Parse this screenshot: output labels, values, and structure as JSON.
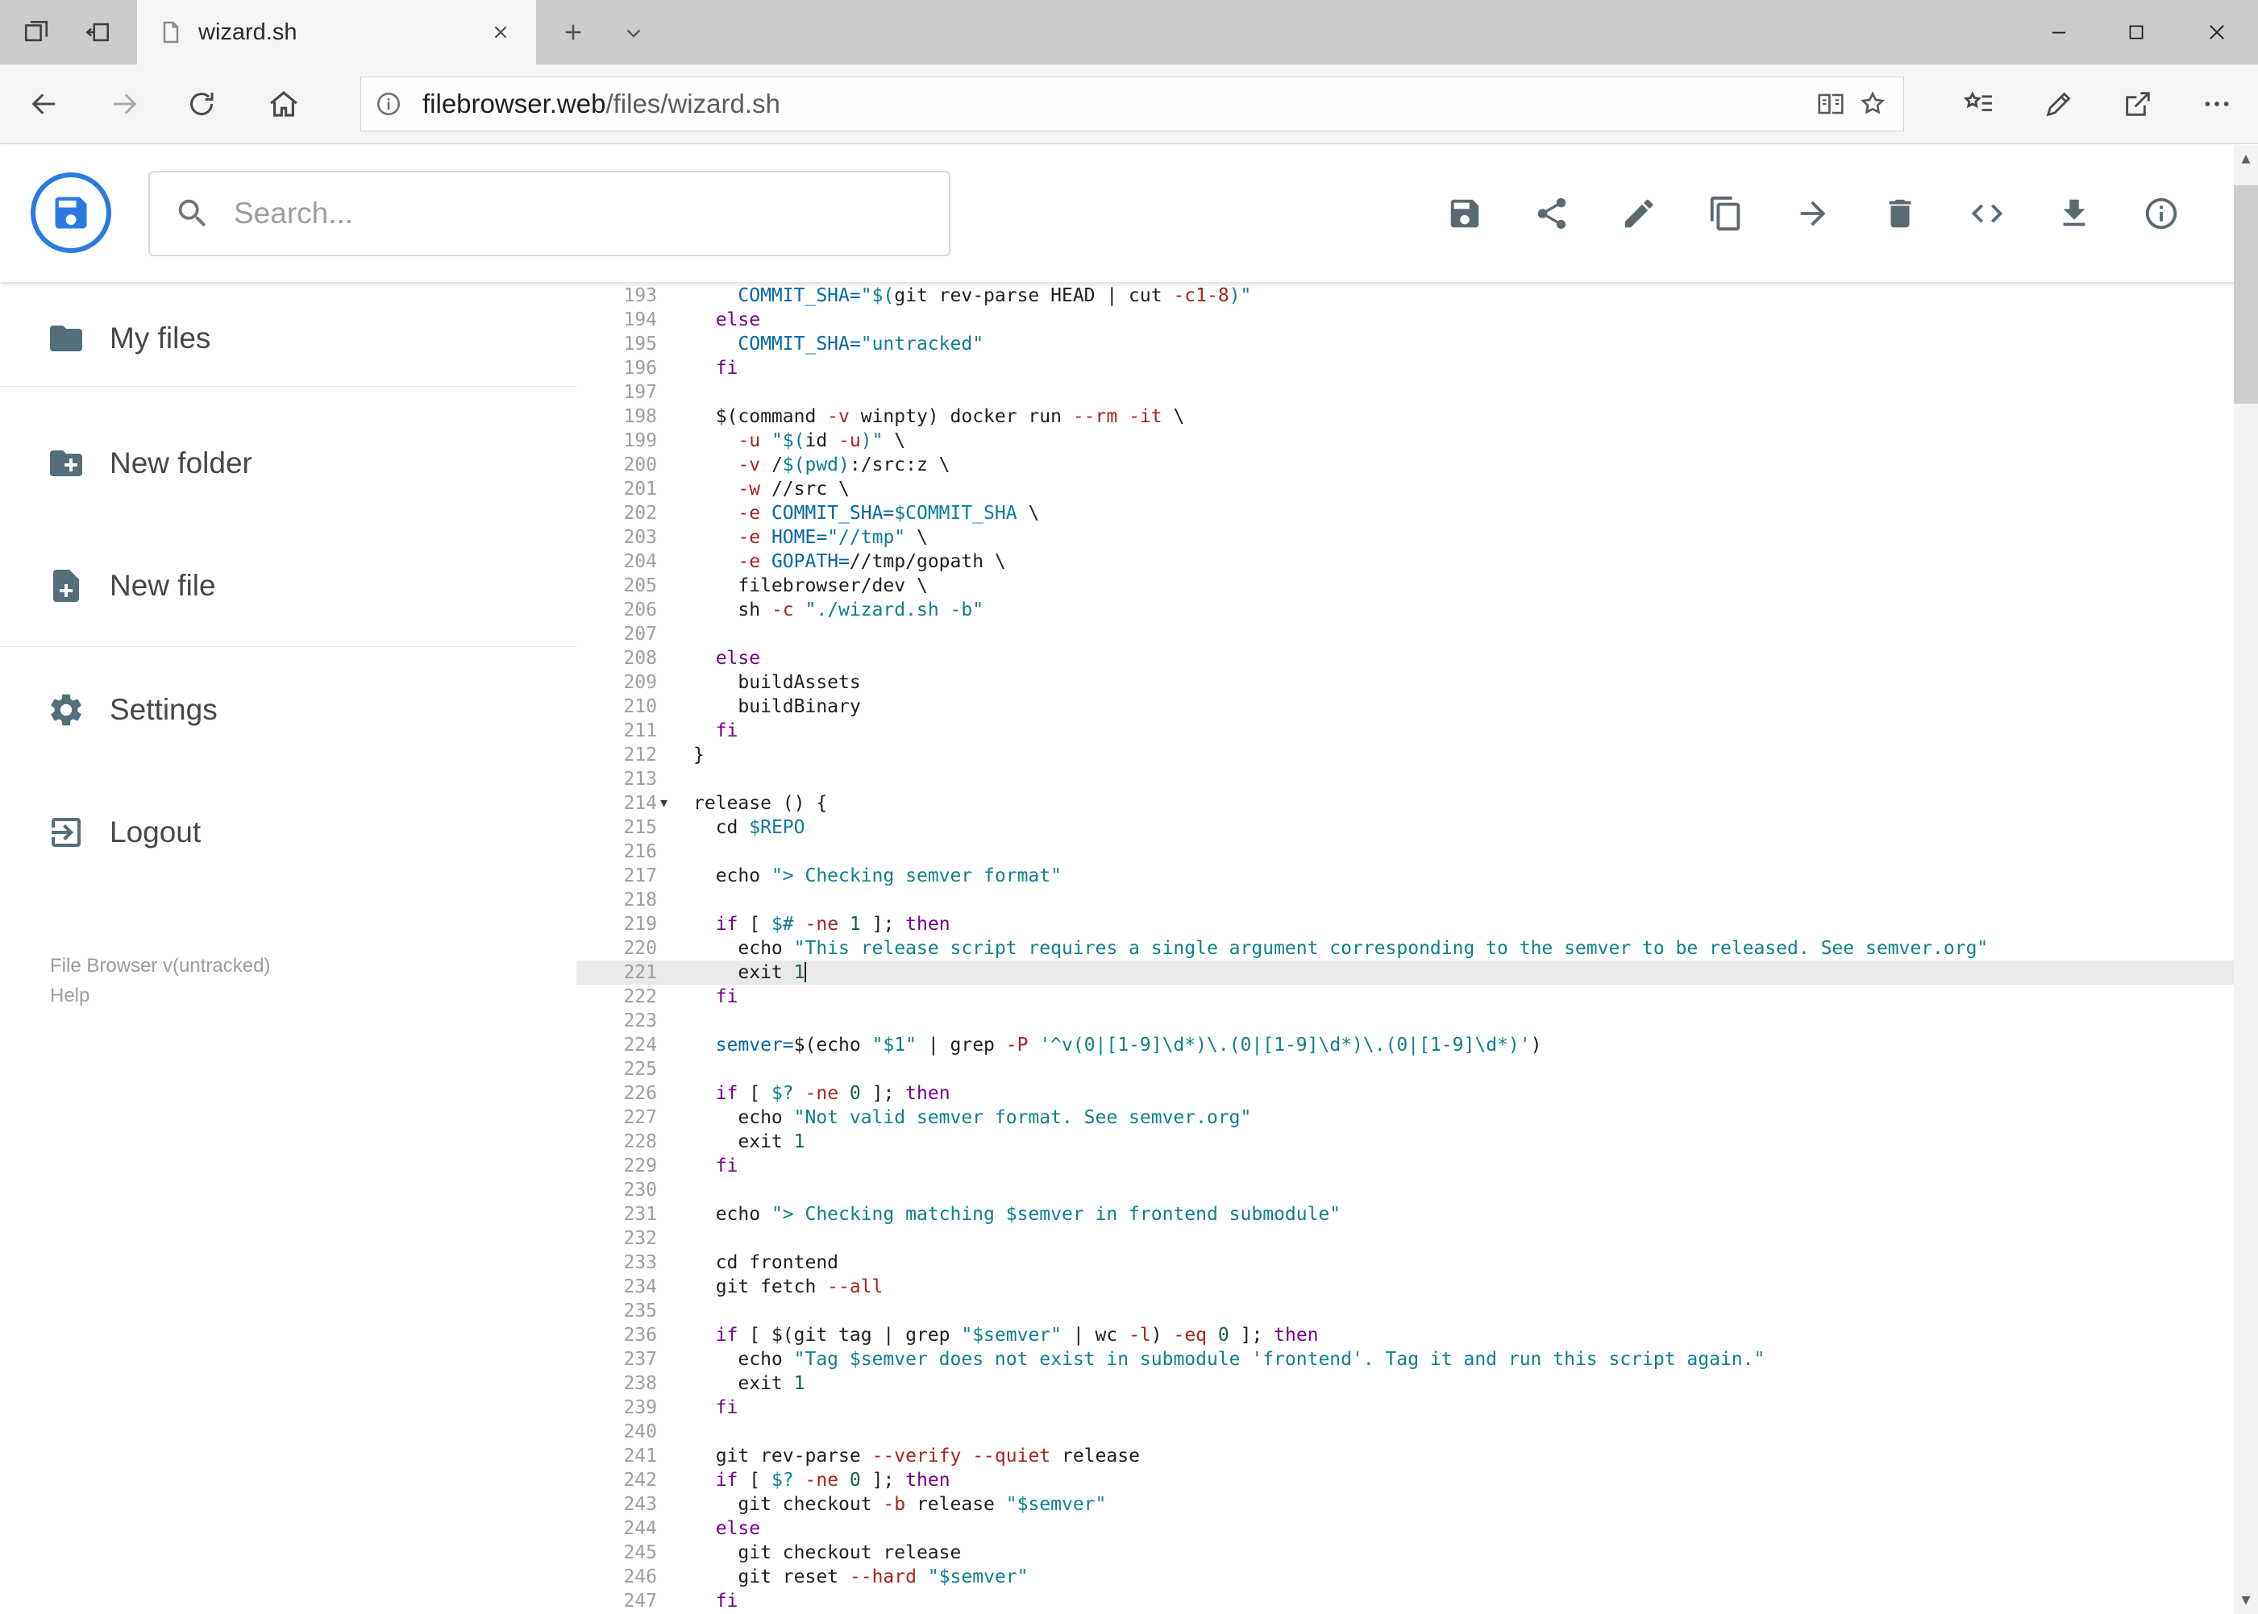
{
  "browser": {
    "tab_title": "wizard.sh",
    "url_host": "filebrowser.web",
    "url_path": "/files/wizard.sh"
  },
  "header": {
    "search_placeholder": "Search...",
    "action_icons": [
      "save",
      "share",
      "edit",
      "copy",
      "move",
      "delete",
      "code",
      "download",
      "info"
    ]
  },
  "sidebar": {
    "items": [
      {
        "icon": "folder",
        "label": "My files"
      },
      {
        "icon": "new-folder",
        "label": "New folder"
      },
      {
        "icon": "new-file",
        "label": "New file"
      },
      {
        "icon": "settings",
        "label": "Settings"
      },
      {
        "icon": "logout",
        "label": "Logout"
      }
    ],
    "footer_version": "File Browser v(untracked)",
    "footer_help": "Help"
  },
  "colors": {
    "accent_blue": "#2a7ae2",
    "header_icon_gray": "#5b6970",
    "sidebar_icon_gray": "#546e7a",
    "active_line_bg": "#e9e9e9"
  },
  "editor": {
    "active_line": 221,
    "fold_line": 214,
    "colors": {
      "p": "#1f1f1f",
      "k": "#770088",
      "s": "#0e7f8e",
      "d": "#0566a6",
      "v": "#0c7d99",
      "num": "#116644",
      "f": "#aa2222",
      "gutter": "#9e9e9e"
    },
    "lines": [
      {
        "n": 193,
        "segs": [
          [
            "p",
            "    "
          ],
          [
            "d",
            "COMMIT_SHA="
          ],
          [
            "s",
            "\"$("
          ],
          [
            "p",
            "git rev-parse HEAD | cut "
          ],
          [
            "f",
            "-c1-8"
          ],
          [
            "s",
            ")\""
          ]
        ]
      },
      {
        "n": 194,
        "segs": [
          [
            "p",
            "  "
          ],
          [
            "k",
            "else"
          ]
        ]
      },
      {
        "n": 195,
        "segs": [
          [
            "p",
            "    "
          ],
          [
            "d",
            "COMMIT_SHA="
          ],
          [
            "s",
            "\"untracked\""
          ]
        ]
      },
      {
        "n": 196,
        "segs": [
          [
            "p",
            "  "
          ],
          [
            "k",
            "fi"
          ]
        ]
      },
      {
        "n": 197,
        "segs": []
      },
      {
        "n": 198,
        "segs": [
          [
            "p",
            "  $(command "
          ],
          [
            "f",
            "-v"
          ],
          [
            "p",
            " winpty) docker run "
          ],
          [
            "f",
            "--rm"
          ],
          [
            "p",
            " "
          ],
          [
            "f",
            "-it"
          ],
          [
            "p",
            " \\"
          ]
        ]
      },
      {
        "n": 199,
        "segs": [
          [
            "p",
            "    "
          ],
          [
            "f",
            "-u"
          ],
          [
            "p",
            " "
          ],
          [
            "s",
            "\"$("
          ],
          [
            "p",
            "id "
          ],
          [
            "f",
            "-u"
          ],
          [
            "s",
            ")\""
          ],
          [
            "p",
            " \\"
          ]
        ]
      },
      {
        "n": 200,
        "segs": [
          [
            "p",
            "    "
          ],
          [
            "f",
            "-v"
          ],
          [
            "p",
            " /"
          ],
          [
            "v",
            "$(pwd)"
          ],
          [
            "p",
            ":/src:z \\"
          ]
        ]
      },
      {
        "n": 201,
        "segs": [
          [
            "p",
            "    "
          ],
          [
            "f",
            "-w"
          ],
          [
            "p",
            " //src \\"
          ]
        ]
      },
      {
        "n": 202,
        "segs": [
          [
            "p",
            "    "
          ],
          [
            "f",
            "-e"
          ],
          [
            "p",
            " "
          ],
          [
            "d",
            "COMMIT_SHA="
          ],
          [
            "v",
            "$COMMIT_SHA"
          ],
          [
            "p",
            " \\"
          ]
        ]
      },
      {
        "n": 203,
        "segs": [
          [
            "p",
            "    "
          ],
          [
            "f",
            "-e"
          ],
          [
            "p",
            " "
          ],
          [
            "d",
            "HOME="
          ],
          [
            "s",
            "\"//tmp\""
          ],
          [
            "p",
            " \\"
          ]
        ]
      },
      {
        "n": 204,
        "segs": [
          [
            "p",
            "    "
          ],
          [
            "f",
            "-e"
          ],
          [
            "p",
            " "
          ],
          [
            "d",
            "GOPATH="
          ],
          [
            "p",
            "//tmp/gopath \\"
          ]
        ]
      },
      {
        "n": 205,
        "segs": [
          [
            "p",
            "    filebrowser/dev \\"
          ]
        ]
      },
      {
        "n": 206,
        "segs": [
          [
            "p",
            "    sh "
          ],
          [
            "f",
            "-c"
          ],
          [
            "p",
            " "
          ],
          [
            "s",
            "\"./wizard.sh -b\""
          ]
        ]
      },
      {
        "n": 207,
        "segs": []
      },
      {
        "n": 208,
        "segs": [
          [
            "p",
            "  "
          ],
          [
            "k",
            "else"
          ]
        ]
      },
      {
        "n": 209,
        "segs": [
          [
            "p",
            "    buildAssets"
          ]
        ]
      },
      {
        "n": 210,
        "segs": [
          [
            "p",
            "    buildBinary"
          ]
        ]
      },
      {
        "n": 211,
        "segs": [
          [
            "p",
            "  "
          ],
          [
            "k",
            "fi"
          ]
        ]
      },
      {
        "n": 212,
        "segs": [
          [
            "p",
            "}"
          ]
        ]
      },
      {
        "n": 213,
        "segs": []
      },
      {
        "n": 214,
        "fold": true,
        "segs": [
          [
            "p",
            "release () {"
          ]
        ]
      },
      {
        "n": 215,
        "segs": [
          [
            "p",
            "  cd "
          ],
          [
            "v",
            "$REPO"
          ]
        ]
      },
      {
        "n": 216,
        "segs": []
      },
      {
        "n": 217,
        "segs": [
          [
            "p",
            "  echo "
          ],
          [
            "s",
            "\"> Checking semver format\""
          ]
        ]
      },
      {
        "n": 218,
        "segs": []
      },
      {
        "n": 219,
        "segs": [
          [
            "p",
            "  "
          ],
          [
            "k",
            "if"
          ],
          [
            "p",
            " [ "
          ],
          [
            "v",
            "$#"
          ],
          [
            "p",
            " "
          ],
          [
            "f",
            "-ne"
          ],
          [
            "p",
            " "
          ],
          [
            "num",
            "1"
          ],
          [
            "p",
            " ]; "
          ],
          [
            "k",
            "then"
          ]
        ]
      },
      {
        "n": 220,
        "segs": [
          [
            "p",
            "    echo "
          ],
          [
            "s",
            "\"This release script requires a single argument corresponding to the semver to be released. See semver.org\""
          ]
        ]
      },
      {
        "n": 221,
        "active": true,
        "cursor": true,
        "segs": [
          [
            "p",
            "    exit "
          ],
          [
            "num",
            "1"
          ]
        ]
      },
      {
        "n": 222,
        "segs": [
          [
            "p",
            "  "
          ],
          [
            "k",
            "fi"
          ]
        ]
      },
      {
        "n": 223,
        "segs": []
      },
      {
        "n": 224,
        "segs": [
          [
            "p",
            "  "
          ],
          [
            "d",
            "semver="
          ],
          [
            "p",
            "$(echo "
          ],
          [
            "s",
            "\"$1\""
          ],
          [
            "p",
            " | grep "
          ],
          [
            "f",
            "-P"
          ],
          [
            "p",
            " "
          ],
          [
            "s",
            "'^v(0|[1-9]\\d*)\\.(0|[1-9]\\d*)\\.(0|[1-9]\\d*)'"
          ],
          [
            "p",
            ")"
          ]
        ]
      },
      {
        "n": 225,
        "segs": []
      },
      {
        "n": 226,
        "segs": [
          [
            "p",
            "  "
          ],
          [
            "k",
            "if"
          ],
          [
            "p",
            " [ "
          ],
          [
            "v",
            "$?"
          ],
          [
            "p",
            " "
          ],
          [
            "f",
            "-ne"
          ],
          [
            "p",
            " "
          ],
          [
            "num",
            "0"
          ],
          [
            "p",
            " ]; "
          ],
          [
            "k",
            "then"
          ]
        ]
      },
      {
        "n": 227,
        "segs": [
          [
            "p",
            "    echo "
          ],
          [
            "s",
            "\"Not valid semver format. See semver.org\""
          ]
        ]
      },
      {
        "n": 228,
        "segs": [
          [
            "p",
            "    exit "
          ],
          [
            "num",
            "1"
          ]
        ]
      },
      {
        "n": 229,
        "segs": [
          [
            "p",
            "  "
          ],
          [
            "k",
            "fi"
          ]
        ]
      },
      {
        "n": 230,
        "segs": []
      },
      {
        "n": 231,
        "segs": [
          [
            "p",
            "  echo "
          ],
          [
            "s",
            "\"> Checking matching "
          ],
          [
            "v",
            "$semver"
          ],
          [
            "s",
            " in frontend submodule\""
          ]
        ]
      },
      {
        "n": 232,
        "segs": []
      },
      {
        "n": 233,
        "segs": [
          [
            "p",
            "  cd frontend"
          ]
        ]
      },
      {
        "n": 234,
        "segs": [
          [
            "p",
            "  git fetch "
          ],
          [
            "f",
            "--all"
          ]
        ]
      },
      {
        "n": 235,
        "segs": []
      },
      {
        "n": 236,
        "segs": [
          [
            "p",
            "  "
          ],
          [
            "k",
            "if"
          ],
          [
            "p",
            " [ $(git tag | grep "
          ],
          [
            "s",
            "\"$semver\""
          ],
          [
            "p",
            " | wc "
          ],
          [
            "f",
            "-l"
          ],
          [
            "p",
            ") "
          ],
          [
            "f",
            "-eq"
          ],
          [
            "p",
            " "
          ],
          [
            "num",
            "0"
          ],
          [
            "p",
            " ]; "
          ],
          [
            "k",
            "then"
          ]
        ]
      },
      {
        "n": 237,
        "segs": [
          [
            "p",
            "    echo "
          ],
          [
            "s",
            "\"Tag "
          ],
          [
            "v",
            "$semver"
          ],
          [
            "s",
            " does not exist in submodule 'frontend'. Tag it and run this script again.\""
          ]
        ]
      },
      {
        "n": 238,
        "segs": [
          [
            "p",
            "    exit "
          ],
          [
            "num",
            "1"
          ]
        ]
      },
      {
        "n": 239,
        "segs": [
          [
            "p",
            "  "
          ],
          [
            "k",
            "fi"
          ]
        ]
      },
      {
        "n": 240,
        "segs": []
      },
      {
        "n": 241,
        "segs": [
          [
            "p",
            "  git rev-parse "
          ],
          [
            "f",
            "--verify"
          ],
          [
            "p",
            " "
          ],
          [
            "f",
            "--quiet"
          ],
          [
            "p",
            " release"
          ]
        ]
      },
      {
        "n": 242,
        "segs": [
          [
            "p",
            "  "
          ],
          [
            "k",
            "if"
          ],
          [
            "p",
            " [ "
          ],
          [
            "v",
            "$?"
          ],
          [
            "p",
            " "
          ],
          [
            "f",
            "-ne"
          ],
          [
            "p",
            " "
          ],
          [
            "num",
            "0"
          ],
          [
            "p",
            " ]; "
          ],
          [
            "k",
            "then"
          ]
        ]
      },
      {
        "n": 243,
        "segs": [
          [
            "p",
            "    git checkout "
          ],
          [
            "f",
            "-b"
          ],
          [
            "p",
            " release "
          ],
          [
            "s",
            "\"$semver\""
          ]
        ]
      },
      {
        "n": 244,
        "segs": [
          [
            "p",
            "  "
          ],
          [
            "k",
            "else"
          ]
        ]
      },
      {
        "n": 245,
        "segs": [
          [
            "p",
            "    git checkout release"
          ]
        ]
      },
      {
        "n": 246,
        "segs": [
          [
            "p",
            "    git reset "
          ],
          [
            "f",
            "--hard"
          ],
          [
            "p",
            " "
          ],
          [
            "s",
            "\"$semver\""
          ]
        ]
      },
      {
        "n": 247,
        "segs": [
          [
            "p",
            "  "
          ],
          [
            "k",
            "fi"
          ]
        ]
      }
    ]
  }
}
